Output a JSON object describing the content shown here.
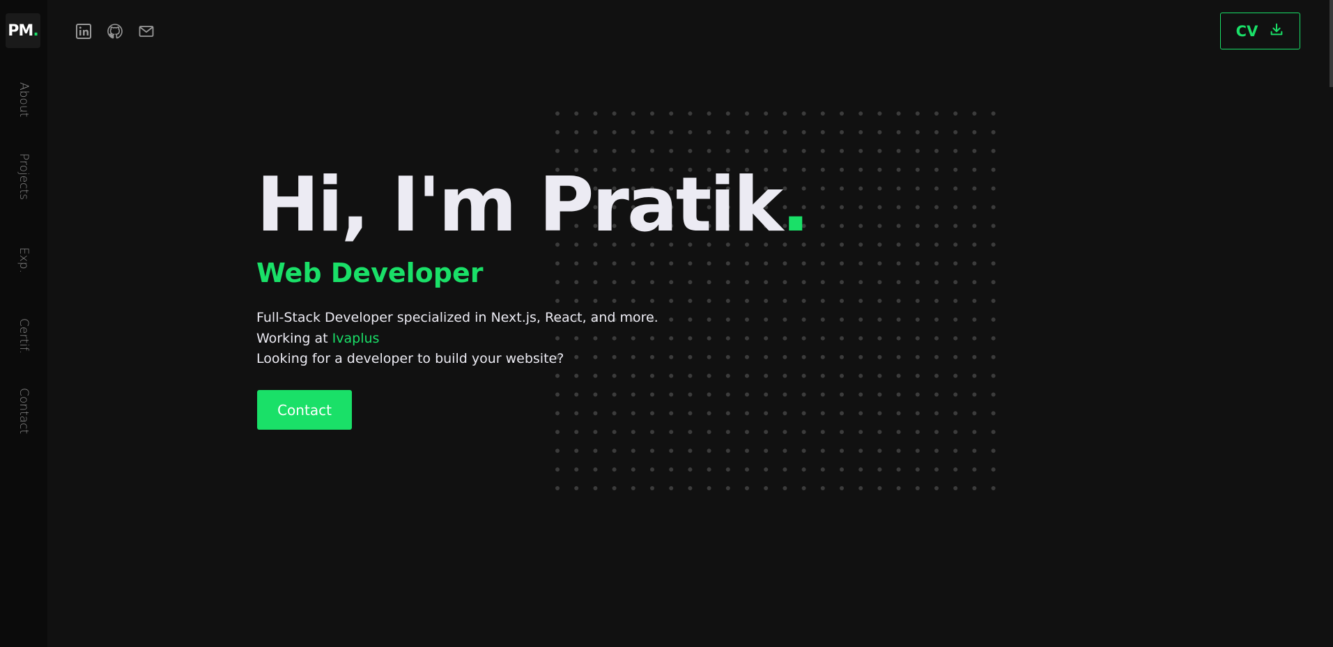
{
  "logo": {
    "text": "PM",
    "dot": "."
  },
  "sidebar": {
    "items": [
      {
        "label": "About"
      },
      {
        "label": "Projects"
      },
      {
        "label": "Exp."
      },
      {
        "label": "Certif."
      },
      {
        "label": "Contact"
      }
    ]
  },
  "social": {
    "icons": [
      "linkedin-icon",
      "github-icon",
      "mail-icon"
    ]
  },
  "cv_button": {
    "label": "CV",
    "icon": "download-icon"
  },
  "hero": {
    "title": "Hi, I'm Pratik",
    "title_dot": ".",
    "role": "Web Developer",
    "line1": "Full-Stack Developer specialized in Next.js, React, and more.",
    "line2_prefix": "Working at ",
    "company": "Ivaplus",
    "line3": "Looking for a developer to build your website?",
    "contact_label": "Contact"
  },
  "colors": {
    "accent": "#1ae068",
    "background": "#111111",
    "sidebar": "#0b0b0b",
    "text": "#ecebf3",
    "muted": "#8c8c8c"
  }
}
